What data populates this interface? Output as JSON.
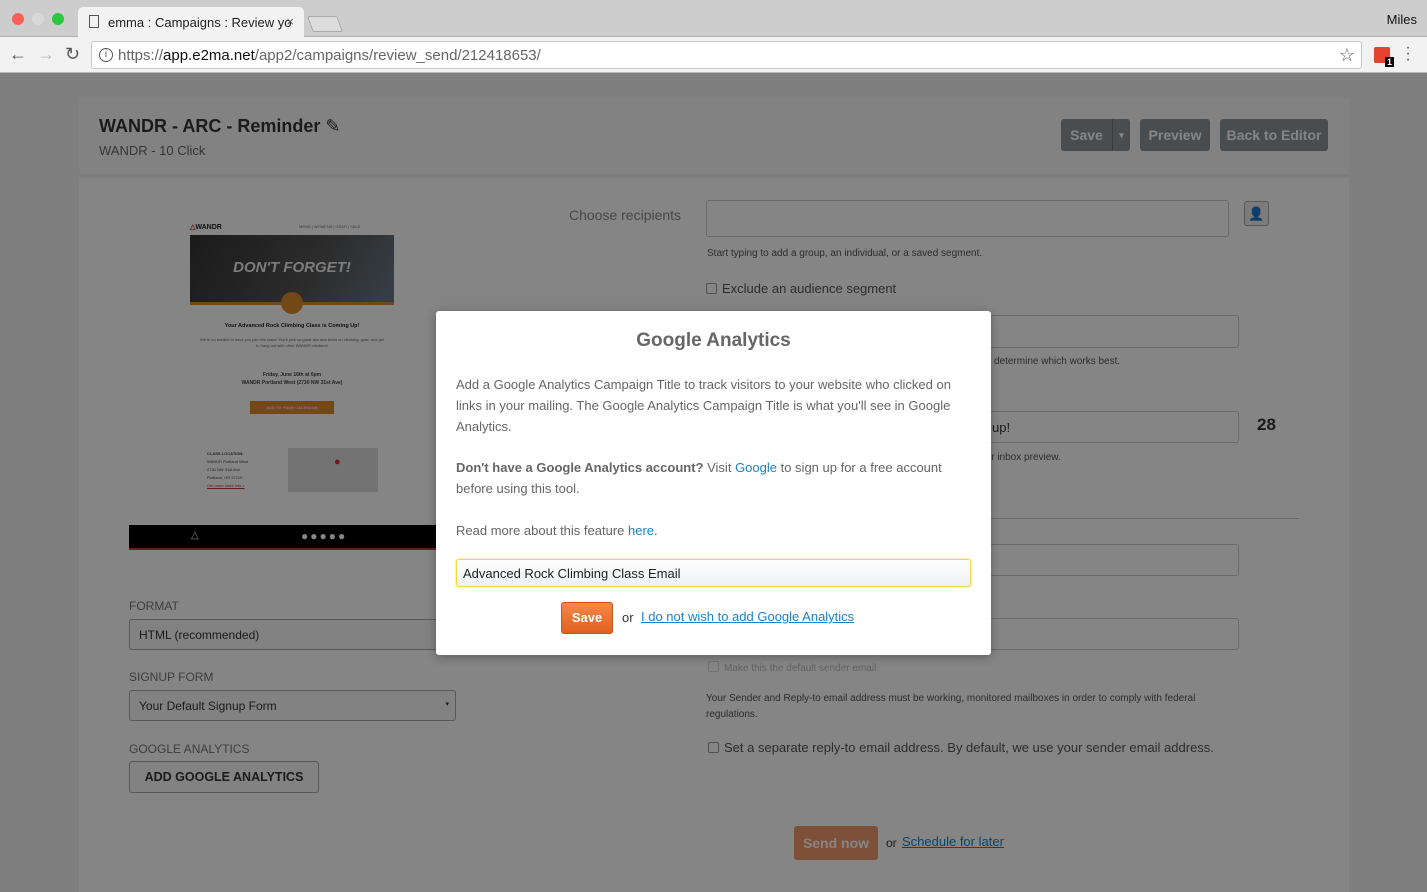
{
  "browser": {
    "tab_title": "emma : Campaigns : Review yo",
    "url_prefix": "https://",
    "url_host": "app.e2ma.net",
    "url_path": "/app2/campaigns/review_send/212418653/",
    "user": "Miles",
    "extension_badge": "1"
  },
  "header": {
    "title": "WANDR - ARC - Reminder",
    "subtitle": "WANDR - 10 Click",
    "save": "Save",
    "preview": "Preview",
    "back": "Back to Editor"
  },
  "email_preview": {
    "brand": "WANDR",
    "nav": "MENS | WOMENS | GEAR | SALE",
    "hero": "DON'T FORGET!",
    "headline": "Your Advanced Rock Climbing Class is Coming Up!",
    "body": "We're so excited to have you join this class! You'll pick up great tips and tricks on climbing, gear, and get to hang out with other WANDR climbers!",
    "date": "Friday, June 16th at 6pm",
    "place": "WANDR Portland West (2730 NW 31st Ave)",
    "cta": "ADD TO YOUR CALENDAR",
    "loc_title": "CLASS LOCATION:",
    "loc_lines": [
      "WANDR Portland West",
      "2730 NW 31st Ave",
      "Portland, OR 97210"
    ],
    "loc_link": "Get more store info »"
  },
  "left": {
    "format_label": "FORMAT",
    "format_value": "HTML (recommended)",
    "signup_label": "SIGNUP FORM",
    "signup_value": "Your Default Signup Form",
    "ga_label": "GOOGLE ANALYTICS",
    "ga_button": "ADD GOOGLE ANALYTICS"
  },
  "right": {
    "recipients_label": "Choose recipients",
    "recipients_hint": "Start typing to add a group, an individual, or a saved segment.",
    "exclude": "Exclude an audience segment",
    "subject_hint_partial": "determine which works best.",
    "preheader_partial": "up!",
    "preheader_count": "28",
    "preheader_hint_partial": "ir inbox preview.",
    "default_sender": "Make this the default sender email",
    "sender_note": "Your Sender and Reply-to email address must be working, monitored mailboxes in order to comply with federal regulations.",
    "reply_to": "Set a separate reply-to email address. By default, we use your sender email address.",
    "send_now": "Send now",
    "or": "or",
    "schedule": "Schedule for later"
  },
  "modal": {
    "title": "Google Analytics",
    "intro": "Add a Google Analytics Campaign Title to track visitors to your website who clicked on links in your mailing. The Google Analytics Campaign Title is what you'll see in Google Analytics.",
    "no_account_bold": "Don't have a Google Analytics account?",
    "visit": " Visit ",
    "google_link": "Google",
    "no_account_rest": " to sign up for a free account before using this tool.",
    "read_more": "Read more about this feature ",
    "here": "here",
    "period": ".",
    "input_value": "Advanced Rock Climbing Class Email",
    "save": "Save",
    "or": "or",
    "decline": "I do not wish to add Google Analytics"
  }
}
